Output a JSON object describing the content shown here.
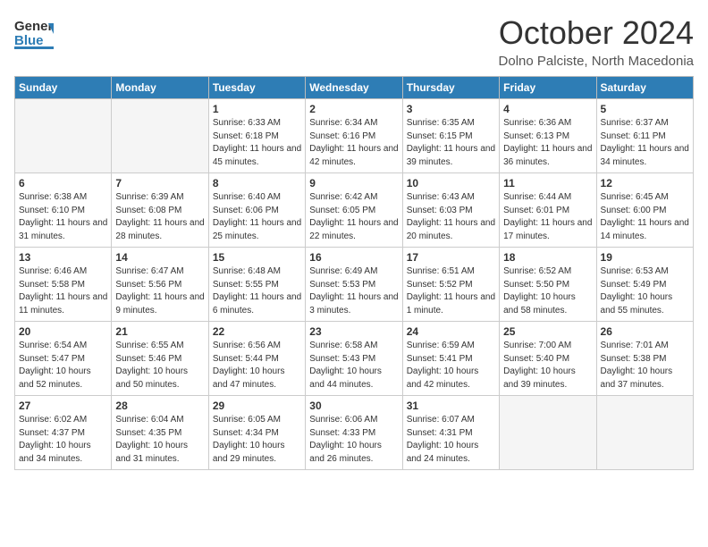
{
  "header": {
    "logo_general": "General",
    "logo_blue": "Blue",
    "month_title": "October 2024",
    "location": "Dolno Palciste, North Macedonia"
  },
  "days_of_week": [
    "Sunday",
    "Monday",
    "Tuesday",
    "Wednesday",
    "Thursday",
    "Friday",
    "Saturday"
  ],
  "weeks": [
    [
      {
        "day": "",
        "info": ""
      },
      {
        "day": "",
        "info": ""
      },
      {
        "day": "1",
        "info": "Sunrise: 6:33 AM\nSunset: 6:18 PM\nDaylight: 11 hours and 45 minutes."
      },
      {
        "day": "2",
        "info": "Sunrise: 6:34 AM\nSunset: 6:16 PM\nDaylight: 11 hours and 42 minutes."
      },
      {
        "day": "3",
        "info": "Sunrise: 6:35 AM\nSunset: 6:15 PM\nDaylight: 11 hours and 39 minutes."
      },
      {
        "day": "4",
        "info": "Sunrise: 6:36 AM\nSunset: 6:13 PM\nDaylight: 11 hours and 36 minutes."
      },
      {
        "day": "5",
        "info": "Sunrise: 6:37 AM\nSunset: 6:11 PM\nDaylight: 11 hours and 34 minutes."
      }
    ],
    [
      {
        "day": "6",
        "info": "Sunrise: 6:38 AM\nSunset: 6:10 PM\nDaylight: 11 hours and 31 minutes."
      },
      {
        "day": "7",
        "info": "Sunrise: 6:39 AM\nSunset: 6:08 PM\nDaylight: 11 hours and 28 minutes."
      },
      {
        "day": "8",
        "info": "Sunrise: 6:40 AM\nSunset: 6:06 PM\nDaylight: 11 hours and 25 minutes."
      },
      {
        "day": "9",
        "info": "Sunrise: 6:42 AM\nSunset: 6:05 PM\nDaylight: 11 hours and 22 minutes."
      },
      {
        "day": "10",
        "info": "Sunrise: 6:43 AM\nSunset: 6:03 PM\nDaylight: 11 hours and 20 minutes."
      },
      {
        "day": "11",
        "info": "Sunrise: 6:44 AM\nSunset: 6:01 PM\nDaylight: 11 hours and 17 minutes."
      },
      {
        "day": "12",
        "info": "Sunrise: 6:45 AM\nSunset: 6:00 PM\nDaylight: 11 hours and 14 minutes."
      }
    ],
    [
      {
        "day": "13",
        "info": "Sunrise: 6:46 AM\nSunset: 5:58 PM\nDaylight: 11 hours and 11 minutes."
      },
      {
        "day": "14",
        "info": "Sunrise: 6:47 AM\nSunset: 5:56 PM\nDaylight: 11 hours and 9 minutes."
      },
      {
        "day": "15",
        "info": "Sunrise: 6:48 AM\nSunset: 5:55 PM\nDaylight: 11 hours and 6 minutes."
      },
      {
        "day": "16",
        "info": "Sunrise: 6:49 AM\nSunset: 5:53 PM\nDaylight: 11 hours and 3 minutes."
      },
      {
        "day": "17",
        "info": "Sunrise: 6:51 AM\nSunset: 5:52 PM\nDaylight: 11 hours and 1 minute."
      },
      {
        "day": "18",
        "info": "Sunrise: 6:52 AM\nSunset: 5:50 PM\nDaylight: 10 hours and 58 minutes."
      },
      {
        "day": "19",
        "info": "Sunrise: 6:53 AM\nSunset: 5:49 PM\nDaylight: 10 hours and 55 minutes."
      }
    ],
    [
      {
        "day": "20",
        "info": "Sunrise: 6:54 AM\nSunset: 5:47 PM\nDaylight: 10 hours and 52 minutes."
      },
      {
        "day": "21",
        "info": "Sunrise: 6:55 AM\nSunset: 5:46 PM\nDaylight: 10 hours and 50 minutes."
      },
      {
        "day": "22",
        "info": "Sunrise: 6:56 AM\nSunset: 5:44 PM\nDaylight: 10 hours and 47 minutes."
      },
      {
        "day": "23",
        "info": "Sunrise: 6:58 AM\nSunset: 5:43 PM\nDaylight: 10 hours and 44 minutes."
      },
      {
        "day": "24",
        "info": "Sunrise: 6:59 AM\nSunset: 5:41 PM\nDaylight: 10 hours and 42 minutes."
      },
      {
        "day": "25",
        "info": "Sunrise: 7:00 AM\nSunset: 5:40 PM\nDaylight: 10 hours and 39 minutes."
      },
      {
        "day": "26",
        "info": "Sunrise: 7:01 AM\nSunset: 5:38 PM\nDaylight: 10 hours and 37 minutes."
      }
    ],
    [
      {
        "day": "27",
        "info": "Sunrise: 6:02 AM\nSunset: 4:37 PM\nDaylight: 10 hours and 34 minutes."
      },
      {
        "day": "28",
        "info": "Sunrise: 6:04 AM\nSunset: 4:35 PM\nDaylight: 10 hours and 31 minutes."
      },
      {
        "day": "29",
        "info": "Sunrise: 6:05 AM\nSunset: 4:34 PM\nDaylight: 10 hours and 29 minutes."
      },
      {
        "day": "30",
        "info": "Sunrise: 6:06 AM\nSunset: 4:33 PM\nDaylight: 10 hours and 26 minutes."
      },
      {
        "day": "31",
        "info": "Sunrise: 6:07 AM\nSunset: 4:31 PM\nDaylight: 10 hours and 24 minutes."
      },
      {
        "day": "",
        "info": ""
      },
      {
        "day": "",
        "info": ""
      }
    ]
  ]
}
